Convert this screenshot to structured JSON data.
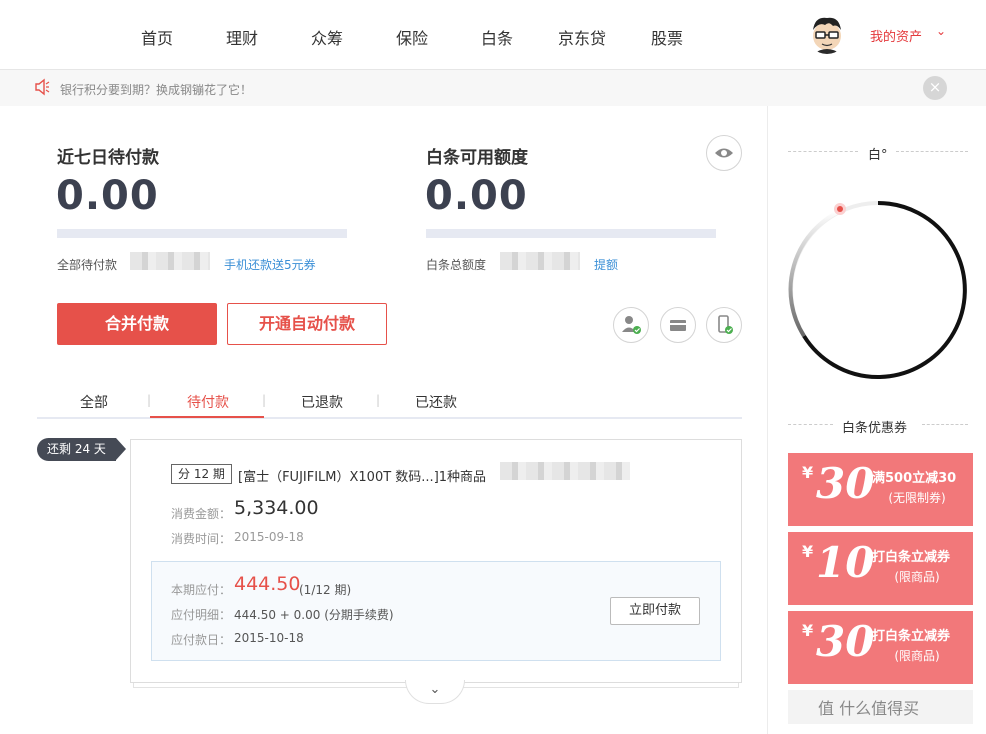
{
  "nav": {
    "items": [
      "首页",
      "理财",
      "众筹",
      "保险",
      "白条",
      "京东贷",
      "股票"
    ],
    "my_assets": "我的资产"
  },
  "notice": {
    "text": "银行积分要到期？换成钢镚花了它！",
    "close": "×"
  },
  "summary": {
    "left": {
      "title": "近七日待付款",
      "amount": "0.00",
      "sub_label": "全部待付款",
      "link": "手机还款送5元券"
    },
    "right": {
      "title": "白条可用额度",
      "amount": "0.00",
      "sub_label": "白条总额度",
      "link": "提额"
    }
  },
  "buttons": {
    "merge_pay": "合并付款",
    "auto_pay": "开通自动付款"
  },
  "tabs": [
    "全部",
    "待付款",
    "已退款",
    "已还款"
  ],
  "active_tab": 1,
  "order": {
    "days_left": "还剩 24 天",
    "period_tag": "分 12 期",
    "title": "[富士（FUJIFILM）X100T 数码...]1种商品",
    "amount_label": "消费金额：",
    "amount": "5,334.00",
    "time_label": "消费时间：",
    "time": "2015-09-18",
    "due_label": "本期应付：",
    "due_amount": "444.50",
    "due_period": "(1/12 期)",
    "detail_label": "应付明细：",
    "detail": "444.50 + 0.00 (分期手续费)",
    "due_date_label": "应付款日：",
    "due_date": "2015-10-18",
    "pay_now": "立即付款",
    "expand": "⌄"
  },
  "sidebar": {
    "score_title": "白°",
    "score_fraction": 0.42,
    "coupons_title": "白条优惠券",
    "coupons": [
      {
        "yen": "¥",
        "amount": "30",
        "line1": "满500立减30",
        "line2": "(无限制券)"
      },
      {
        "yen": "¥",
        "amount": "10",
        "line1": "打白条立减券",
        "line2": "(限商品)"
      },
      {
        "yen": "¥",
        "amount": "30",
        "line1": "打白条立减券",
        "line2": "(限商品)"
      }
    ],
    "footer_text": "值 什么值得买"
  },
  "colors": {
    "red": "#e6514a",
    "coupon": "#f2787a",
    "blue": "#3b8fd6",
    "dark": "#3c4150"
  }
}
